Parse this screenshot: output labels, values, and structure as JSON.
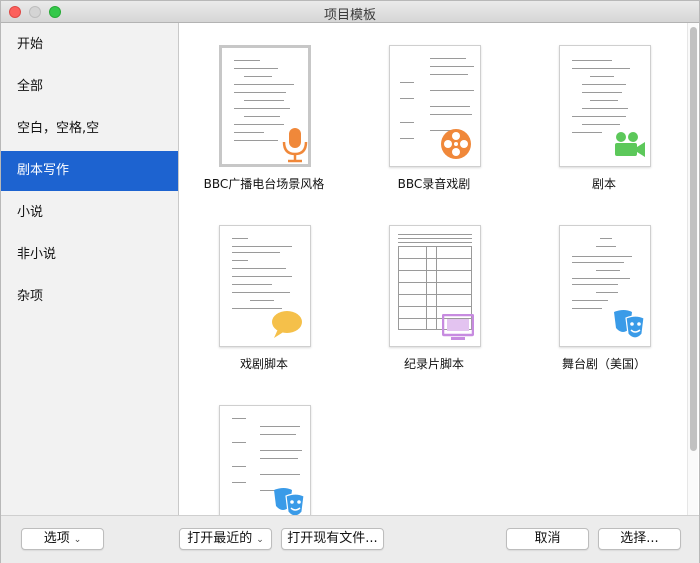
{
  "window": {
    "title": "项目模板"
  },
  "sidebar": {
    "items": [
      {
        "label": "开始"
      },
      {
        "label": "全部"
      },
      {
        "label": "空白，空格,空"
      },
      {
        "label": "剧本写作"
      },
      {
        "label": "小说"
      },
      {
        "label": "非小说"
      },
      {
        "label": "杂项"
      }
    ],
    "selected": "剧本写作"
  },
  "templates": [
    {
      "label": "BBC广播电台场景风格",
      "badge": "microphone-icon",
      "badge_color": "#f0883a"
    },
    {
      "label": "BBC录音戏剧",
      "badge": "film-reel-icon",
      "badge_color": "#f0883a"
    },
    {
      "label": "剧本",
      "badge": "movie-camera-icon",
      "badge_color": "#5cc85a"
    },
    {
      "label": "戏剧脚本",
      "badge": "speech-bubble-icon",
      "badge_color": "#f5c04a"
    },
    {
      "label": "纪录片脚本",
      "badge": "monitor-icon",
      "badge_color": "#c78be0"
    },
    {
      "label": "舞台剧（美国）",
      "badge": "theater-masks-icon",
      "badge_color": "#3a9be8"
    },
    {
      "label": "",
      "badge": "theater-masks-icon",
      "badge_color": "#3a9be8"
    }
  ],
  "footer": {
    "options_label": "选项",
    "recent_label": "打开最近的",
    "open_existing_label": "打开现有文件...",
    "cancel_label": "取消",
    "choose_label": "选择..."
  }
}
